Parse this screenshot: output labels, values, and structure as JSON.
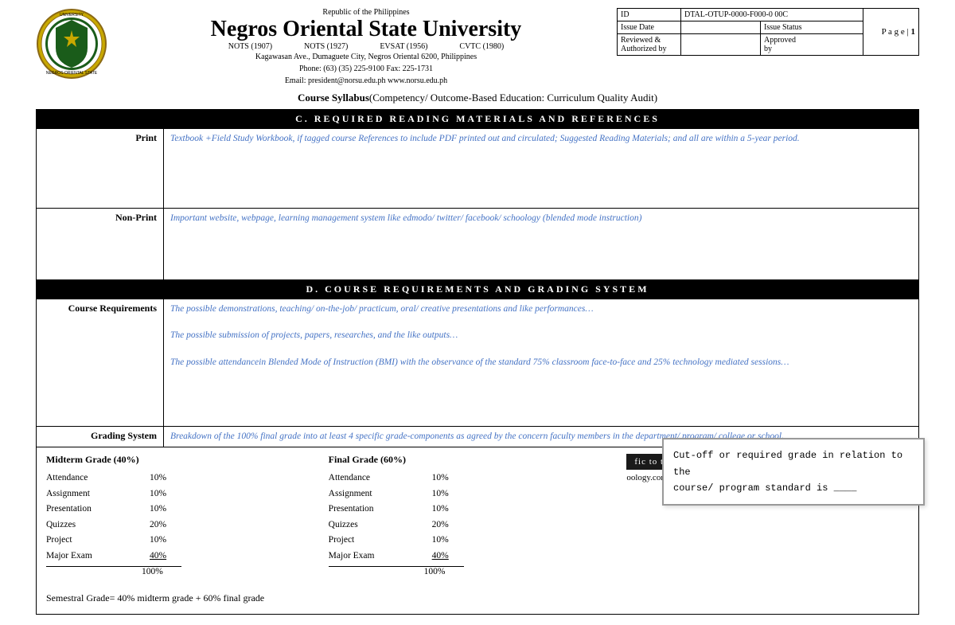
{
  "header": {
    "republic": "Republic of the Philippines",
    "university": "Negros Oriental State University",
    "acronyms": [
      "NOTS (1907)",
      "NOTS (1927)",
      "EVSAT (1956)",
      "CVTC (1980)"
    ],
    "address_line1": "Kagawasan Ave., Dumaguete City, Negros Oriental 6200, Philippines",
    "address_line2": "Phone: (63) (35) 225-9100               Fax: 225-1731",
    "address_line3": "Email: president@norsu.edu.ph              www.norsu.edu.ph"
  },
  "info_table": {
    "id_label": "ID",
    "id_value": "DTAL-OTUP-0000-F000-0 00C",
    "issue_date_label": "Issue Date",
    "issue_status_label": "Issue Status",
    "reviewed_label": "Reviewed &",
    "authorized_label": "Authorized by",
    "approved_label": "Approved",
    "approved_by_label": "by",
    "page_label": "P a g e",
    "page_number": "1"
  },
  "course_syllabus_title": "Course Syllabus",
  "course_syllabus_subtitle": "(Competency/ Outcome-Based Education: Curriculum Quality Audit)",
  "sections": {
    "reading_materials_header": "C.  REQUIRED READING MATERIALS AND REFERENCES",
    "print_label": "Print",
    "print_content": "Textbook +Field Study Workbook, if tagged course References to include PDF printed out and circulated; Suggested  Reading Materials; and all are within a 5-year period.",
    "non_print_label": "Non-Print",
    "non_print_content": "Important website, webpage, learning management system like edmodo/ twitter/ facebook/ schoology (blended mode instruction)",
    "requirements_header": "D.  COURSE REQUIREMENTS AND GRADING SYSTEM",
    "course_req_label": "Course Requirements",
    "course_req_1": "The possible demonstrations, teaching/ on-the-job/ practicum, oral/ creative presentations and like performances…",
    "course_req_2": "The possible submission of projects, papers, researches, and the like outputs…",
    "course_req_3": "The possible attendancein Blended Mode of Instruction (BMI) with the observance of the standard 75% classroom face-to-face and 25% technology mediated sessions…",
    "grading_label": "Grading System",
    "grading_content": "Breakdown of the 100% final grade into at least 4 specific grade-components as agreed by the concern faculty members in the department/ program/ college or school."
  },
  "grading": {
    "midterm_title": "Midterm Grade (40%)",
    "final_title": "Final Grade (60%)",
    "midterm_items": [
      {
        "label": "Attendance",
        "pct": "10%"
      },
      {
        "label": "Assignment",
        "pct": "10%"
      },
      {
        "label": "Presentation",
        "pct": "10%"
      },
      {
        "label": "Quizzes",
        "pct": "20%"
      },
      {
        "label": "Project",
        "pct": "10%"
      },
      {
        "label": "Major Exam",
        "pct": "40%"
      }
    ],
    "midterm_total": "100%",
    "final_items": [
      {
        "label": "Attendance",
        "pct": "10%"
      },
      {
        "label": "Assignment",
        "pct": "10%"
      },
      {
        "label": "Presentation",
        "pct": "10%"
      },
      {
        "label": "Quizzes",
        "pct": "20%"
      },
      {
        "label": "Project",
        "pct": "10%"
      },
      {
        "label": "Major Exam",
        "pct": "40%"
      }
    ],
    "final_total": "100%",
    "semestral_formula": "Semestral Grade= 40% midterm grade + 60% final grade"
  },
  "dark_bar_text": "fic to the Course",
  "dark_bar_sub": "oology.com. Enrollment to M",
  "tooltip": {
    "line1": "Cut-off or required grade in relation to the",
    "line2": "course/ program standard is ____"
  },
  "logo": {
    "circle_color": "#c8a800",
    "inner_color": "#1a5c1a"
  }
}
